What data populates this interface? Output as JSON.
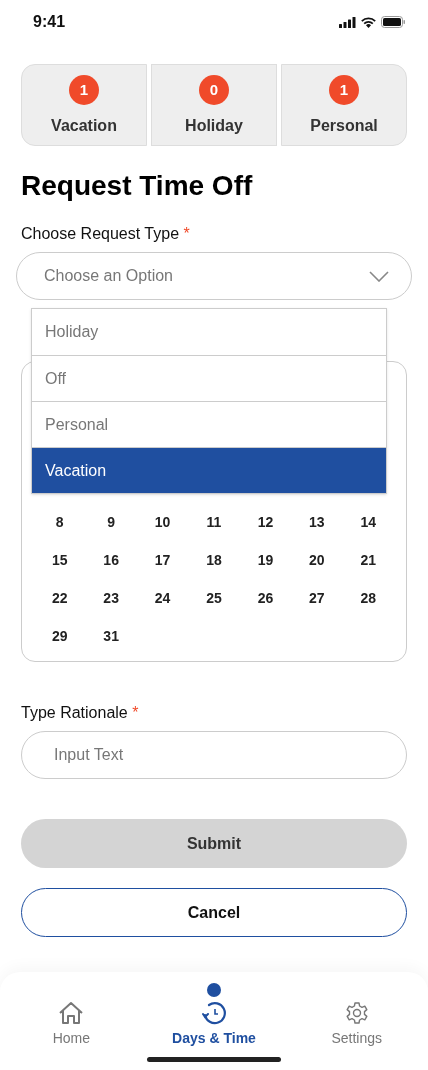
{
  "status_bar": {
    "time": "9:41"
  },
  "balances": [
    {
      "count": "1",
      "label": "Vacation"
    },
    {
      "count": "0",
      "label": "Holiday"
    },
    {
      "count": "1",
      "label": "Personal"
    }
  ],
  "title": "Request Time Off",
  "request_type": {
    "label": "Choose Request Type",
    "required_mark": "*",
    "placeholder": "Choose an Option",
    "expanded": true,
    "options": [
      {
        "label": "Holiday",
        "selected": false
      },
      {
        "label": "Off",
        "selected": false
      },
      {
        "label": "Personal",
        "selected": false
      },
      {
        "label": "Vacation",
        "selected": true
      }
    ]
  },
  "calendar": {
    "weeks": [
      [
        "8",
        "9",
        "10",
        "11",
        "12",
        "13",
        "14"
      ],
      [
        "15",
        "16",
        "17",
        "18",
        "19",
        "20",
        "21"
      ],
      [
        "22",
        "23",
        "24",
        "25",
        "26",
        "27",
        "28"
      ],
      [
        "29",
        "31"
      ]
    ]
  },
  "rationale": {
    "label": "Type Rationale",
    "required_mark": "*",
    "placeholder": "Input Text"
  },
  "submit": {
    "label": "Submit",
    "disabled": true
  },
  "cancel": {
    "label": "Cancel"
  },
  "nav": [
    {
      "kind": "home",
      "label": "Home",
      "selected": false
    },
    {
      "kind": "history",
      "label": "Days & Time",
      "selected": true
    },
    {
      "kind": "settings",
      "label": "Settings",
      "selected": false
    }
  ]
}
